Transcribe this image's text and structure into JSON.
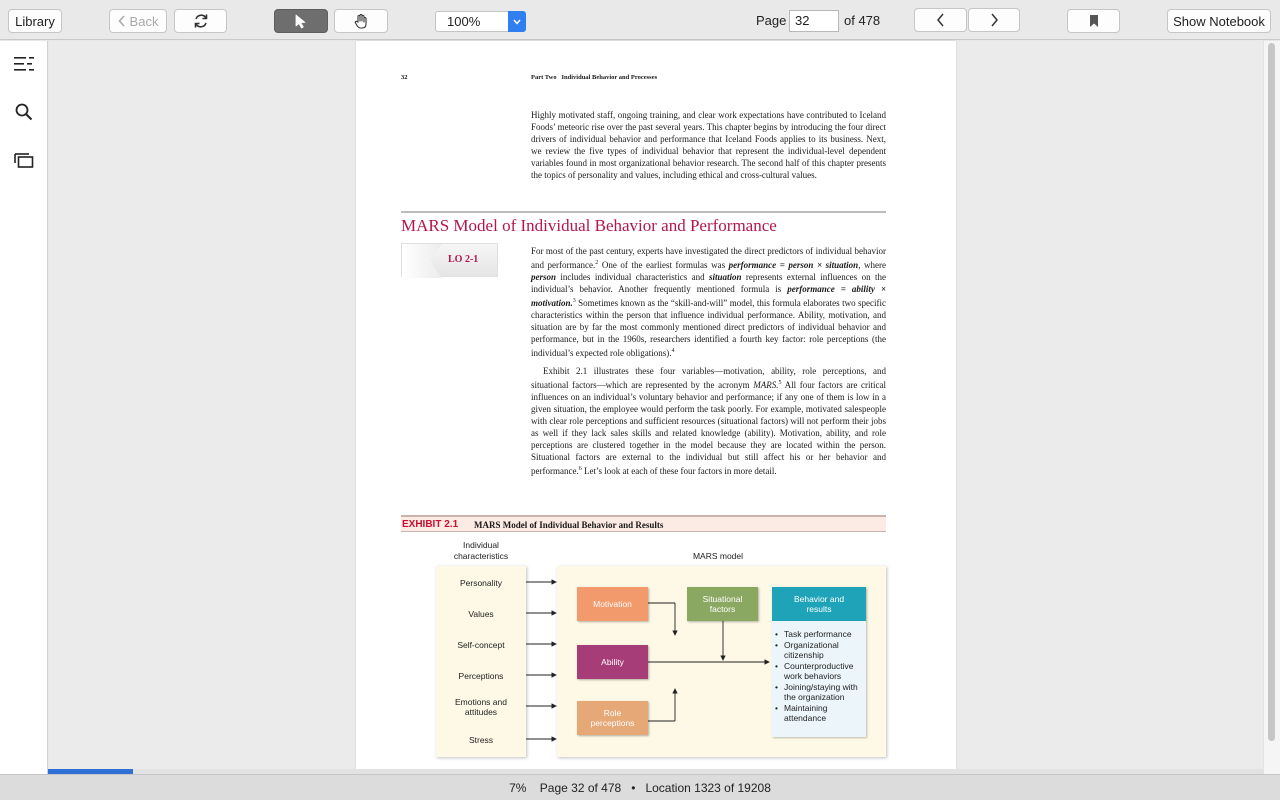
{
  "toolbar": {
    "library_label": "Library",
    "back_label": "Back",
    "zoom_value": "100%",
    "page_label": "Page",
    "page_value": "32",
    "page_of": "of 478",
    "notebook_label": "Show Notebook"
  },
  "sidebar": {
    "icons": [
      "table-of-contents-icon",
      "search-icon",
      "pages-icon"
    ]
  },
  "page": {
    "number": "32",
    "running_head_part": "Part Two",
    "running_head_title": "Individual Behavior and Processes",
    "intro": "Highly motivated staff, ongoing training, and clear work expectations have contributed to Iceland Foods’ meteoric rise over the past several years. This chapter begins by introducing the four direct drivers of individual behavior and performance that Iceland Foods applies to its business. Next, we review the five types of individual behavior that represent the individual-level dependent variables found in most organizational behavior research. The second half of this chapter presents the topics of personality and values, including ethical and cross-cultural values.",
    "heading": "MARS Model of Individual Behavior and Performance",
    "lo_badge": "LO 2-1",
    "p1a": "For most of the past century, experts have investigated the direct predictors of individual behavior and performance.",
    "p1b": " One of the earliest formulas was ",
    "p1c": "performance = person × situation",
    "p1d": ", where ",
    "p1e": "person",
    "p1f": " includes individual characteristics and ",
    "p1g": "situation",
    "p1h": " represents external influences on the individual’s behavior. Another frequently mentioned formula is ",
    "p1i": "performance = ability × motivation.",
    "p1j": " Sometimes known as the “skill-and-will” model, this formula elaborates two specific characteristics within the person that influence individual performance. Ability, motivation, and situation are by far the most commonly mentioned direct predictors of individual behavior and performance, but in the 1960s, researchers identified a fourth key factor: role perceptions (the individual’s expected role obligations).",
    "p2a": "Exhibit 2.1 illustrates these four variables—motivation, ability, role perceptions, and situational factors—which are represented by the acronym ",
    "p2b": "MARS.",
    "p2c": " All four factors are critical influences on an individual’s voluntary behavior and performance; if any one of them is low in a given situation, the employee would perform the task poorly. For example, motivated salespeople with clear role perceptions and sufficient resources (situational factors) will not perform their jobs as well if they lack sales skills and related knowledge (ability). Motivation, ability, and role perceptions are clustered together in the model because they are located within the person. Situational factors are external to the individual but still affect his or her behavior and performance.",
    "p2d": " Let’s look at each of these four factors in more detail.",
    "fn2": "2",
    "fn3": "3",
    "fn4": "4",
    "fn5": "5",
    "fn6": "6"
  },
  "exhibit": {
    "number": "EXHIBIT 2.1",
    "title": "MARS Model of Individual Behavior and Results",
    "left_header": "Individual characteristics",
    "right_header": "MARS model",
    "characteristics": [
      "Personality",
      "Values",
      "Self-concept",
      "Perceptions",
      "Emotions and attitudes",
      "Stress"
    ],
    "motivation": "Motivation",
    "ability": "Ability",
    "role": "Role perceptions",
    "situational": "Situational factors",
    "results_title": "Behavior and results",
    "results": [
      "Task performance",
      "Organizational citizenship",
      "Counterproductive work behaviors",
      "Joining/staying with the organization",
      "Maintaining attendance"
    ],
    "colors": {
      "motivation": "#f39a6c",
      "ability": "#a63d78",
      "role": "#e6a876",
      "situational": "#8ba863",
      "results": "#1fa3b8"
    }
  },
  "reading_progress": 0.07,
  "status": {
    "percent": "7%",
    "page": "Page 32 of 478",
    "sep": "•",
    "location": "Location 1323 of 19208"
  }
}
